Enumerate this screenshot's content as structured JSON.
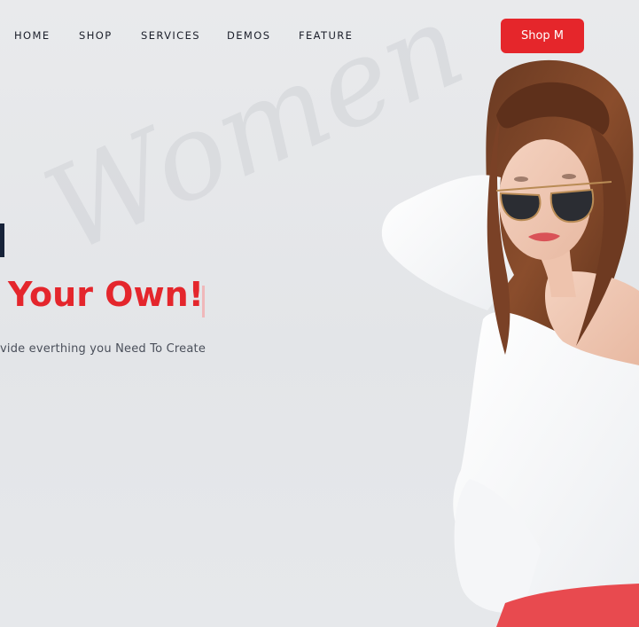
{
  "nav": {
    "items": [
      {
        "label": "HOME"
      },
      {
        "label": "SHOP"
      },
      {
        "label": "SERVICES"
      },
      {
        "label": "DEMOS"
      },
      {
        "label": "FEATURE"
      }
    ],
    "cta_label": "Shop M"
  },
  "hero": {
    "watermark": "Women",
    "title": "Your Own!",
    "subtitle": "vide everthing you Need To Create"
  },
  "colors": {
    "accent": "#e5262b",
    "navy": "#172339",
    "background": "#e6e8eb"
  },
  "icons": {
    "model_image": "woman-in-sunglasses"
  }
}
